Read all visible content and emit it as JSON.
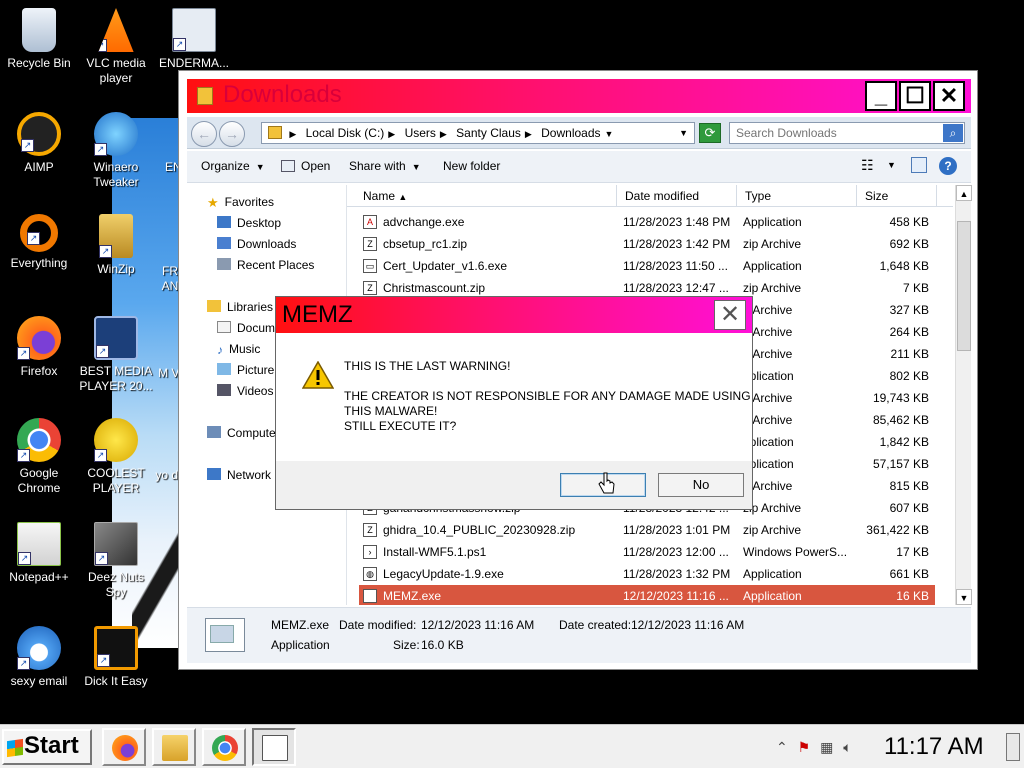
{
  "desktop": {
    "icons": [
      {
        "label": "Recycle Bin",
        "icon": "recycle-bin-icon",
        "color": "#c9d6e6"
      },
      {
        "label": "VLC media player",
        "icon": "vlc-cone-icon",
        "color": "#ff8c00"
      },
      {
        "label": "ENDERMA...",
        "icon": "window-app-icon",
        "color": "#d9e2ec"
      },
      {
        "label": "AIMP",
        "icon": "aimp-icon",
        "color": "#f6a800"
      },
      {
        "label": "Winaero Tweaker",
        "icon": "winaero-globe-icon",
        "color": "#2d8fe0"
      },
      {
        "label": "ENI",
        "icon": "window-app-icon",
        "color": "#d9e2ec"
      },
      {
        "label": "Everything",
        "icon": "everything-ring-icon",
        "color": "#f07800"
      },
      {
        "label": "WinZip",
        "icon": "winzip-cabinet-icon",
        "color": "#d8b24a"
      },
      {
        "label": "FR AN",
        "icon": "app-icon",
        "color": "#cc3333"
      },
      {
        "label": "Firefox",
        "icon": "firefox-icon",
        "color": "#ff6a1a"
      },
      {
        "label": "BEST MEDIA PLAYER 20...",
        "icon": "xmplay-icon",
        "color": "#1c3f7a"
      },
      {
        "label": "M Vi",
        "icon": "app-icon",
        "color": "#3b64b0"
      },
      {
        "label": "Google Chrome",
        "icon": "chrome-icon",
        "color": "#34a853"
      },
      {
        "label": "COOLEST PLAYER",
        "icon": "smiley-icon",
        "color": "#f4d21c"
      },
      {
        "label": "yo do",
        "icon": "app-icon",
        "color": "#cc2222"
      },
      {
        "label": "Notepad++",
        "icon": "notepad-plus-plus-icon",
        "color": "#8bc34a"
      },
      {
        "label": "Deez Nuts Spy",
        "icon": "windows-stack-icon",
        "color": "#555555"
      },
      {
        "label": "sexy email",
        "icon": "thunderbird-icon",
        "color": "#2b7fd8"
      },
      {
        "label": "Dick It Easy",
        "icon": "de-badge-icon",
        "color": "#f29a00"
      }
    ]
  },
  "explorer": {
    "title": "Downloads",
    "address": [
      "Local Disk (C:)",
      "Users",
      "Santy Claus",
      "Downloads"
    ],
    "search_placeholder": "Search Downloads",
    "toolbar": {
      "organize": "Organize",
      "open": "Open",
      "share_with": "Share with",
      "new_folder": "New folder"
    },
    "nav": {
      "favorites": "Favorites",
      "desktop": "Desktop",
      "downloads": "Downloads",
      "recent_places": "Recent Places",
      "libraries": "Libraries",
      "documents": "Docum",
      "music": "Music",
      "pictures": "Picture",
      "videos": "Videos",
      "computer": "Compute",
      "network": "Network"
    },
    "columns": {
      "name": "Name",
      "date": "Date modified",
      "type": "Type",
      "size": "Size"
    },
    "files": [
      {
        "name": "advchange.exe",
        "date": "11/28/2023 1:48 PM",
        "type": "Application",
        "size": "458 KB",
        "icon": "acrobat-icon"
      },
      {
        "name": "cbsetup_rc1.zip",
        "date": "11/28/2023 1:42 PM",
        "type": "zip Archive",
        "size": "692 KB",
        "icon": "zip-icon"
      },
      {
        "name": "Cert_Updater_v1.6.exe",
        "date": "11/28/2023 11:50 ...",
        "type": "Application",
        "size": "1,648 KB",
        "icon": "exe-icon"
      },
      {
        "name": "Christmascount.zip",
        "date": "11/28/2023 12:47 ...",
        "type": "zip Archive",
        "size": "7 KB",
        "icon": "zip-icon"
      },
      {
        "name": "",
        "date": "",
        "type": "p Archive",
        "size": "327 KB",
        "icon": "zip-icon"
      },
      {
        "name": "",
        "date": "",
        "type": "p Archive",
        "size": "264 KB",
        "icon": "zip-icon"
      },
      {
        "name": "",
        "date": "",
        "type": "p Archive",
        "size": "211 KB",
        "icon": "zip-icon"
      },
      {
        "name": "",
        "date": "",
        "type": "pplication",
        "size": "802 KB",
        "icon": "exe-icon"
      },
      {
        "name": "",
        "date": "",
        "type": "p Archive",
        "size": "19,743 KB",
        "icon": "zip-icon"
      },
      {
        "name": "",
        "date": "",
        "type": "p Archive",
        "size": "85,462 KB",
        "icon": "zip-icon"
      },
      {
        "name": "",
        "date": "",
        "type": "pplication",
        "size": "1,842 KB",
        "icon": "exe-icon"
      },
      {
        "name": "",
        "date": "",
        "type": "pplication",
        "size": "57,157 KB",
        "icon": "exe-icon"
      },
      {
        "name": "",
        "date": "",
        "type": "p Archive",
        "size": "815 KB",
        "icon": "zip-icon"
      },
      {
        "name": "gahandchristmasshow.zip",
        "date": "11/28/2023 12:42 ...",
        "type": "zip Archive",
        "size": "607 KB",
        "icon": "zip-icon"
      },
      {
        "name": "ghidra_10.4_PUBLIC_20230928.zip",
        "date": "11/28/2023 1:01 PM",
        "type": "zip Archive",
        "size": "361,422 KB",
        "icon": "zip-icon"
      },
      {
        "name": "Install-WMF5.1.ps1",
        "date": "11/28/2023 12:00 ...",
        "type": "Windows PowerS...",
        "size": "17 KB",
        "icon": "script-icon"
      },
      {
        "name": "LegacyUpdate-1.9.exe",
        "date": "11/28/2023 1:32 PM",
        "type": "Application",
        "size": "661 KB",
        "icon": "globe-icon"
      },
      {
        "name": "MEMZ.exe",
        "date": "12/12/2023 11:16 ...",
        "type": "Application",
        "size": "16 KB",
        "icon": "exe-icon",
        "selected": true
      }
    ],
    "details": {
      "name": "MEMZ.exe",
      "kind": "Application",
      "date_modified_label": "Date modified:",
      "date_modified": "12/12/2023 11:16 AM",
      "date_created_label": "Date created:",
      "date_created": "12/12/2023 11:16 AM",
      "size_label": "Size:",
      "size": "16.0 KB"
    }
  },
  "dialog": {
    "title": "MEMZ",
    "line1": "THIS IS THE LAST WARNING!",
    "line2": "THE CREATOR IS NOT RESPONSIBLE FOR ANY DAMAGE MADE USING",
    "line3": "THIS MALWARE!",
    "line4": "STILL EXECUTE IT?",
    "yes_label": "",
    "no_label": "No"
  },
  "taskbar": {
    "start_label": "Start",
    "apps": [
      "firefox-icon",
      "explorer-folder-icon",
      "chrome-icon",
      "memz-app-icon"
    ],
    "clock": "11:17 AM"
  },
  "colors": {
    "title_gradient_start": "#ff1010",
    "title_gradient_end": "#ff10d8",
    "selection": "#d8563f"
  }
}
